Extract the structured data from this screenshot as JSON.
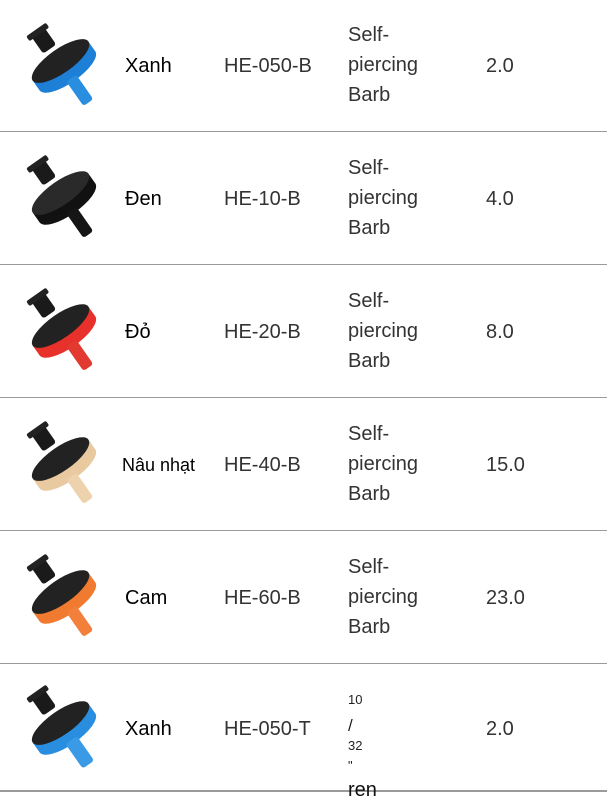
{
  "rows": [
    {
      "color": "Xanh",
      "model": "HE-050-B",
      "connection": [
        "Self-",
        "piercing",
        "Barb"
      ],
      "flow": "2.0",
      "icon": "dripper-blue-icon",
      "accent": "#1e7fd6"
    },
    {
      "color": "Đen",
      "model": "HE-10-B",
      "connection": [
        "Self-",
        "piercing",
        "Barb"
      ],
      "flow": "4.0",
      "icon": "dripper-black-icon",
      "accent": "#1a1a1a"
    },
    {
      "color": "Đỏ",
      "model": "HE-20-B",
      "connection": [
        "Self-",
        "piercing",
        "Barb"
      ],
      "flow": "8.0",
      "icon": "dripper-red-icon",
      "accent": "#e8312b"
    },
    {
      "color": "Nâu nhạt",
      "model": "HE-40-B",
      "connection": [
        "Self-",
        "piercing",
        "Barb"
      ],
      "flow": "15.0",
      "icon": "dripper-tan-icon",
      "accent": "#e8c9a0"
    },
    {
      "color": "Cam",
      "model": "HE-60-B",
      "connection": [
        "Self-",
        "piercing",
        "Barb"
      ],
      "flow": "23.0",
      "icon": "dripper-orange-icon",
      "accent": "#f07a30"
    },
    {
      "color": "Xanh",
      "model": "HE-050-T",
      "thread_num": "10",
      "thread_den": "32",
      "thread_unit": "\"",
      "thread_word": "ren",
      "flow": "2.0",
      "icon": "dripper-blue-threaded-icon",
      "accent": "#2a8ee0"
    }
  ]
}
